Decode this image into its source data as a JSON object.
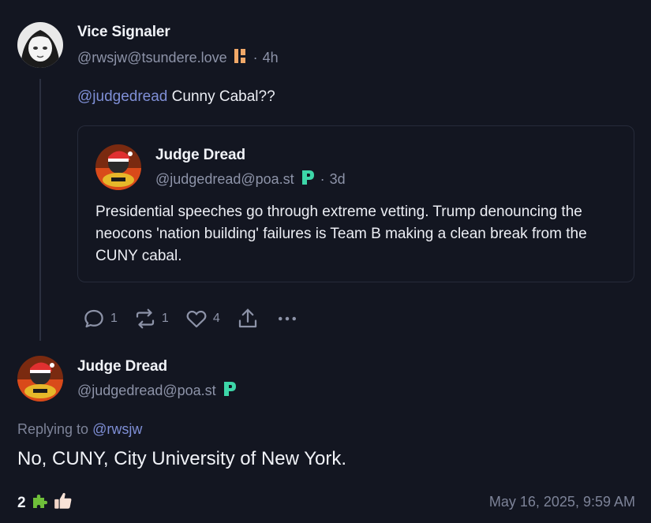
{
  "reply_post": {
    "author_name": "Vice Signaler",
    "author_handle": "@rwsjw@tsundere.love",
    "time_ago": "4h",
    "mention": "@judgedread",
    "text": " Cunny Cabal??",
    "colors": {
      "instance_badge": "#f0a868"
    }
  },
  "quoted_post": {
    "author_name": "Judge Dread",
    "author_handle": "@judgedread@poa.st",
    "time_ago": "3d",
    "text": "Presidential speeches go through extreme vetting. Trump denouncing the neocons 'nation building' failures is Team B making a clean break from the CUNY cabal.",
    "colors": {
      "instance_badge": "#3dd6a8"
    }
  },
  "actions": {
    "reply_count": "1",
    "repost_count": "1",
    "like_count": "4",
    "icons": [
      "reply-icon",
      "repost-icon",
      "like-icon",
      "share-icon",
      "more-icon"
    ]
  },
  "main_post": {
    "author_name": "Judge Dread",
    "author_handle": "@judgedread@poa.st",
    "replying_prefix": "Replying to ",
    "replying_mention": "@rwsjw",
    "text": "No, CUNY, City University of New York.",
    "reaction_count": "2",
    "reaction_emojis": [
      "puzzle-piece-emoji",
      "thumbs-up-emoji"
    ],
    "timestamp": "May 16, 2025, 9:59 AM"
  },
  "colors": {
    "background": "#131621",
    "mention": "#7f8fd6",
    "muted": "#8d93a8"
  }
}
